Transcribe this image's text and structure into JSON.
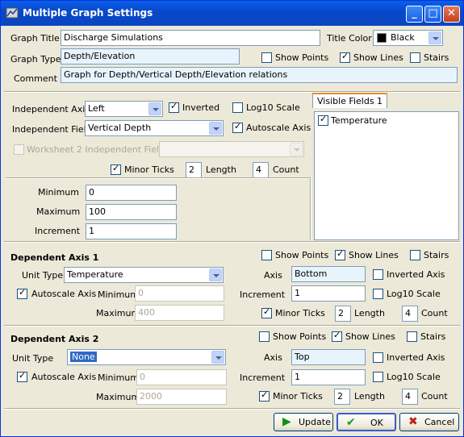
{
  "window": {
    "title": "Multiple Graph Settings"
  },
  "graph": {
    "title_label": "Graph Title",
    "title_value": "Discharge Simulations",
    "type_label": "Graph Type",
    "type_value": "Depth/Elevation",
    "comment_label": "Comment",
    "comment_value": "Graph for Depth/Vertical Depth/Elevation relations",
    "title_color_label": "Title Color",
    "title_color_value": "Black",
    "title_color_hex": "#000000",
    "show_points_label": "Show Points",
    "show_points": false,
    "show_lines_label": "Show Lines",
    "show_lines": true,
    "stairs_label": "Stairs",
    "stairs": false
  },
  "independent": {
    "axis_label": "Independent Axis",
    "axis_value": "Left",
    "inverted_label": "Inverted",
    "inverted": true,
    "log10_label": "Log10 Scale",
    "log10": false,
    "field_label": "Independent Field",
    "field_value": "Vertical Depth",
    "autoscale_label": "Autoscale Axis",
    "autoscale": true,
    "ws2_label": "Worksheet 2 Independent Field",
    "minor_ticks_label": "Minor Ticks",
    "minor_ticks": true,
    "length_label": "Length",
    "length_value": "2",
    "count_label": "Count",
    "count_value": "4",
    "minimum_label": "Minimum",
    "minimum_value": "0",
    "maximum_label": "Maximum",
    "maximum_value": "100",
    "increment_label": "Increment",
    "increment_value": "1"
  },
  "visible_fields": {
    "tab_label": "Visible Fields 1",
    "items": [
      {
        "label": "Temperature",
        "checked": true
      }
    ]
  },
  "dep1": {
    "header": "Dependent Axis 1",
    "show_points_label": "Show Points",
    "show_lines_label": "Show Lines",
    "stairs_label": "Stairs",
    "unit_type_label": "Unit Type",
    "unit_type_value": "Temperature",
    "axis_label": "Axis",
    "axis_value": "Bottom",
    "inverted_label": "Inverted Axis",
    "autoscale_label": "Autoscale Axis",
    "minimum_label": "Minimum",
    "minimum_value": "0",
    "maximum_label": "Maximum",
    "maximum_value": "400",
    "increment_label": "Increment",
    "increment_value": "1",
    "log10_label": "Log10 Scale",
    "minor_ticks_label": "Minor Ticks",
    "length_label": "Length",
    "length_value": "2",
    "count_label": "Count",
    "count_value": "4"
  },
  "dep2": {
    "header": "Dependent Axis 2",
    "show_points_label": "Show Points",
    "show_lines_label": "Show Lines",
    "stairs_label": "Stairs",
    "unit_type_label": "Unit Type",
    "unit_type_value": "None",
    "axis_label": "Axis",
    "axis_value": "Top",
    "inverted_label": "Inverted Axis",
    "autoscale_label": "Autoscale Axis",
    "minimum_label": "Minimum",
    "minimum_value": "0",
    "maximum_label": "Maximum",
    "maximum_value": "2000",
    "increment_label": "Increment",
    "increment_value": "1",
    "log10_label": "Log10 Scale",
    "minor_ticks_label": "Minor Ticks",
    "length_label": "Length",
    "length_value": "2",
    "count_label": "Count",
    "count_value": "4"
  },
  "buttons": {
    "update": "Update",
    "ok": "OK",
    "cancel": "Cancel"
  },
  "colors": {
    "titlebar": "#0a5fe9",
    "face": "#ece9d8",
    "check": "#21a121",
    "selection": "#316ac5"
  },
  "icons": {
    "update": "play-icon",
    "ok": "checkmark-icon",
    "cancel": "x-icon"
  }
}
